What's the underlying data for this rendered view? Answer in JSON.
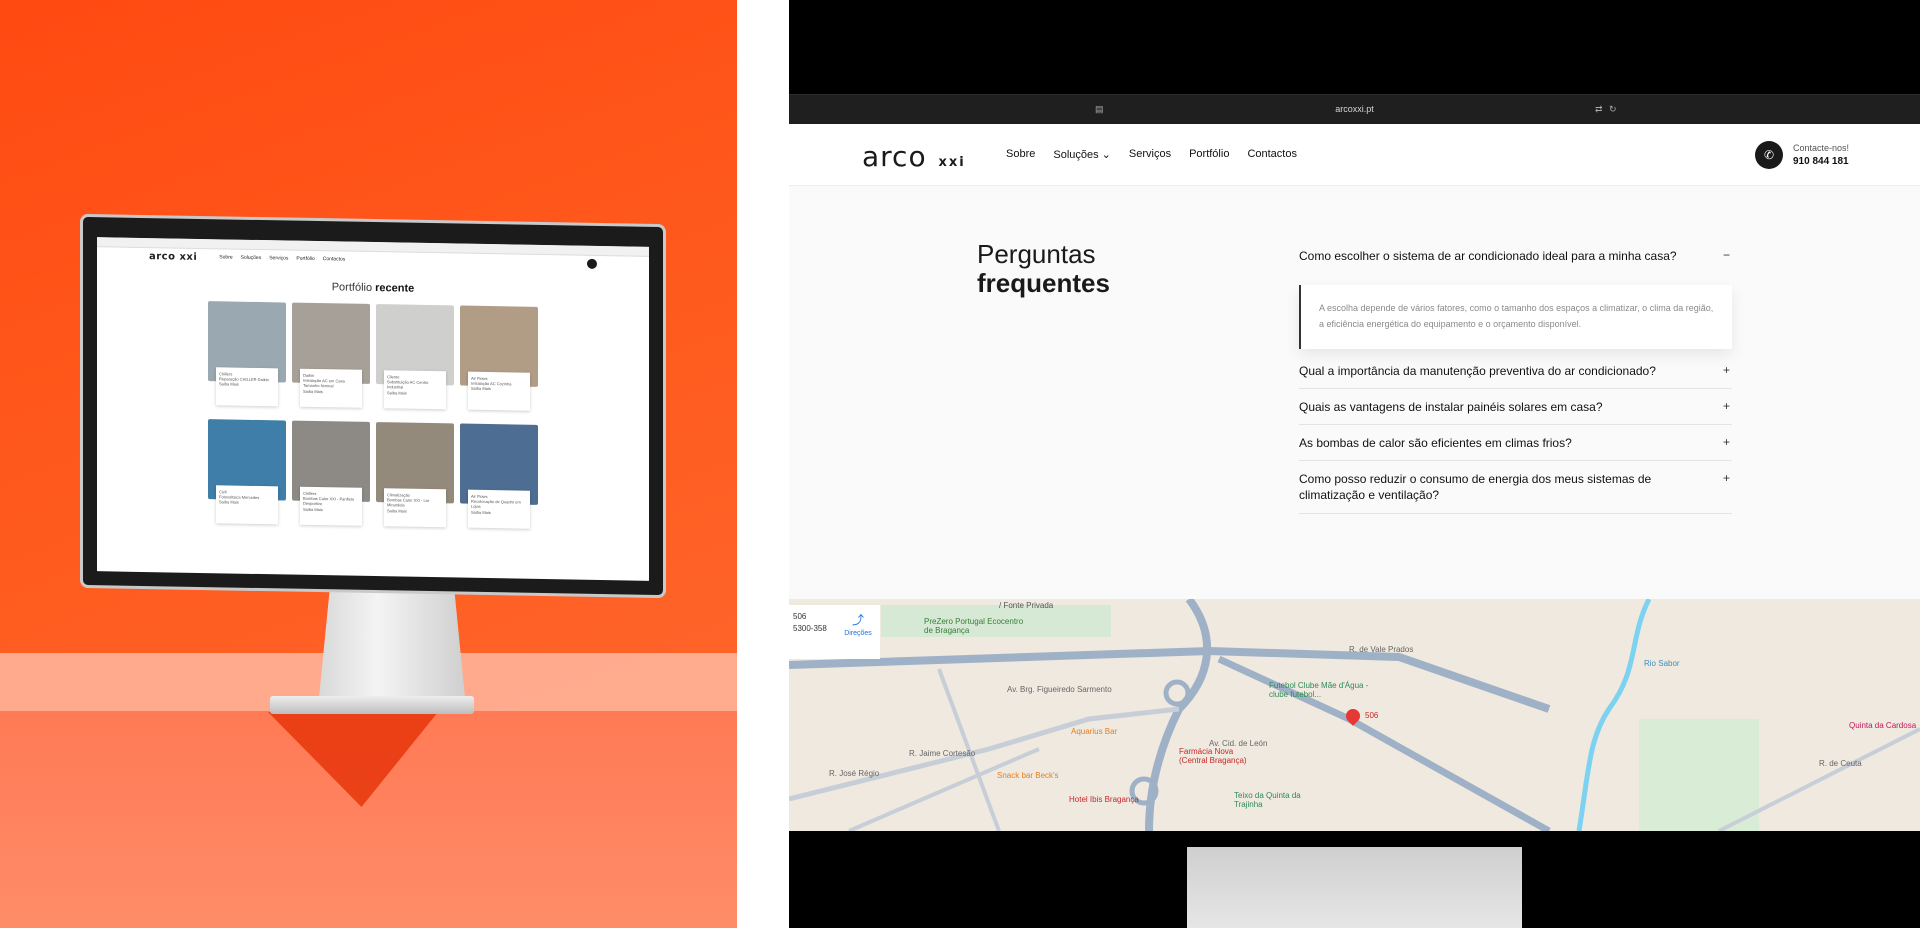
{
  "colors": {
    "accent": "#ff4a12",
    "dark": "#1a1a1a"
  },
  "left": {
    "mini_site": {
      "logo": "arco xxi",
      "nav": [
        "Sobre",
        "Soluções",
        "Serviços",
        "Portfólio",
        "Contactos"
      ],
      "title_light": "Portfólio",
      "title_bold": "recente",
      "cards": [
        {
          "tag": "Chillers",
          "title": "Reparação CHILLER Daikin",
          "link": "Saiba Mais",
          "color": "#9aa8b1"
        },
        {
          "tag": "Daikin",
          "title": "Instalação AC em Casa Tamanho Normal",
          "link": "Saiba Mais",
          "color": "#a7a099"
        },
        {
          "tag": "Cliente",
          "title": "Substituição AC Centro Industrial",
          "link": "Saiba Mais",
          "color": "#cfcfcd"
        },
        {
          "tag": "Air Flows",
          "title": "Instalação AC Cozinha",
          "link": "Saiba Mais",
          "color": "#b19d86"
        },
        {
          "tag": "Civil",
          "title": "Fotovoltaica Mercedes",
          "link": "Saiba Mais",
          "color": "#3f7ea8"
        },
        {
          "tag": "Chillers",
          "title": "Bombas Calor XXI - Panfleto Desportivo",
          "link": "Saiba Mais",
          "color": "#8d8a85"
        },
        {
          "tag": "Climatização",
          "title": "Bombas Calor XXI - Lar Mirandela",
          "link": "Saiba Mais",
          "color": "#948a7c"
        },
        {
          "tag": "Air Flows",
          "title": "Recolocação de Quadro em Lojas",
          "link": "Saiba Mais",
          "color": "#4d6d92"
        }
      ]
    }
  },
  "browser": {
    "url": "arcoxxi.pt"
  },
  "header": {
    "logo_main": "arco",
    "logo_sub": "xxi",
    "nav": [
      "Sobre",
      "Soluções ⌄",
      "Serviços",
      "Portfólio",
      "Contactos"
    ],
    "contact_label": "Contacte-nos!",
    "phone": "910 844 181"
  },
  "faq": {
    "title_light": "Perguntas",
    "title_bold": "frequentes",
    "open_question": "Como escolher o sistema de ar condicionado ideal para a minha casa?",
    "open_answer": "A escolha depende de vários fatores, como o tamanho dos espaços a climatizar, o clima da região, a eficiência energética do equipamento e o orçamento disponível.",
    "questions": [
      "Qual a importância da manutenção preventiva do ar condicionado?",
      "Quais as vantagens de instalar painéis solares em casa?",
      "As bombas de calor são eficientes em climas frios?",
      "Como posso reduzir o consumo de energia dos meus sistemas de climatização e ventilação?"
    ],
    "minus": "−",
    "plus": "+"
  },
  "map": {
    "card_line1": "506",
    "card_line2": "5300-358",
    "directions": "Direções",
    "labels": {
      "fonte": "/ Fonte Privada",
      "prezero": "PreZero Portugal Ecocentro de Bragança",
      "futebol": "Futebol Clube Mãe d'Água - clube futebol...",
      "pin": "506",
      "aquarius": "Aquarius Bar",
      "farmacia": "Farmácia Nova (Central Bragança)",
      "snack": "Snack bar Beck's",
      "ibis": "Hotel Ibis Bragança",
      "teixo": "Teixo da Quinta da Trajinha",
      "figueiredo": "Av. Brg. Figueiredo Sarmento",
      "leon": "Av. Cid. de León",
      "vale": "R. de Vale Prados",
      "sabor": "Rio Sabor",
      "quinta": "Quinta da Cardosa",
      "jaime": "R. Jaime Cortesão",
      "jose": "R. José Régio",
      "ceuta": "R. de Ceuta"
    }
  }
}
